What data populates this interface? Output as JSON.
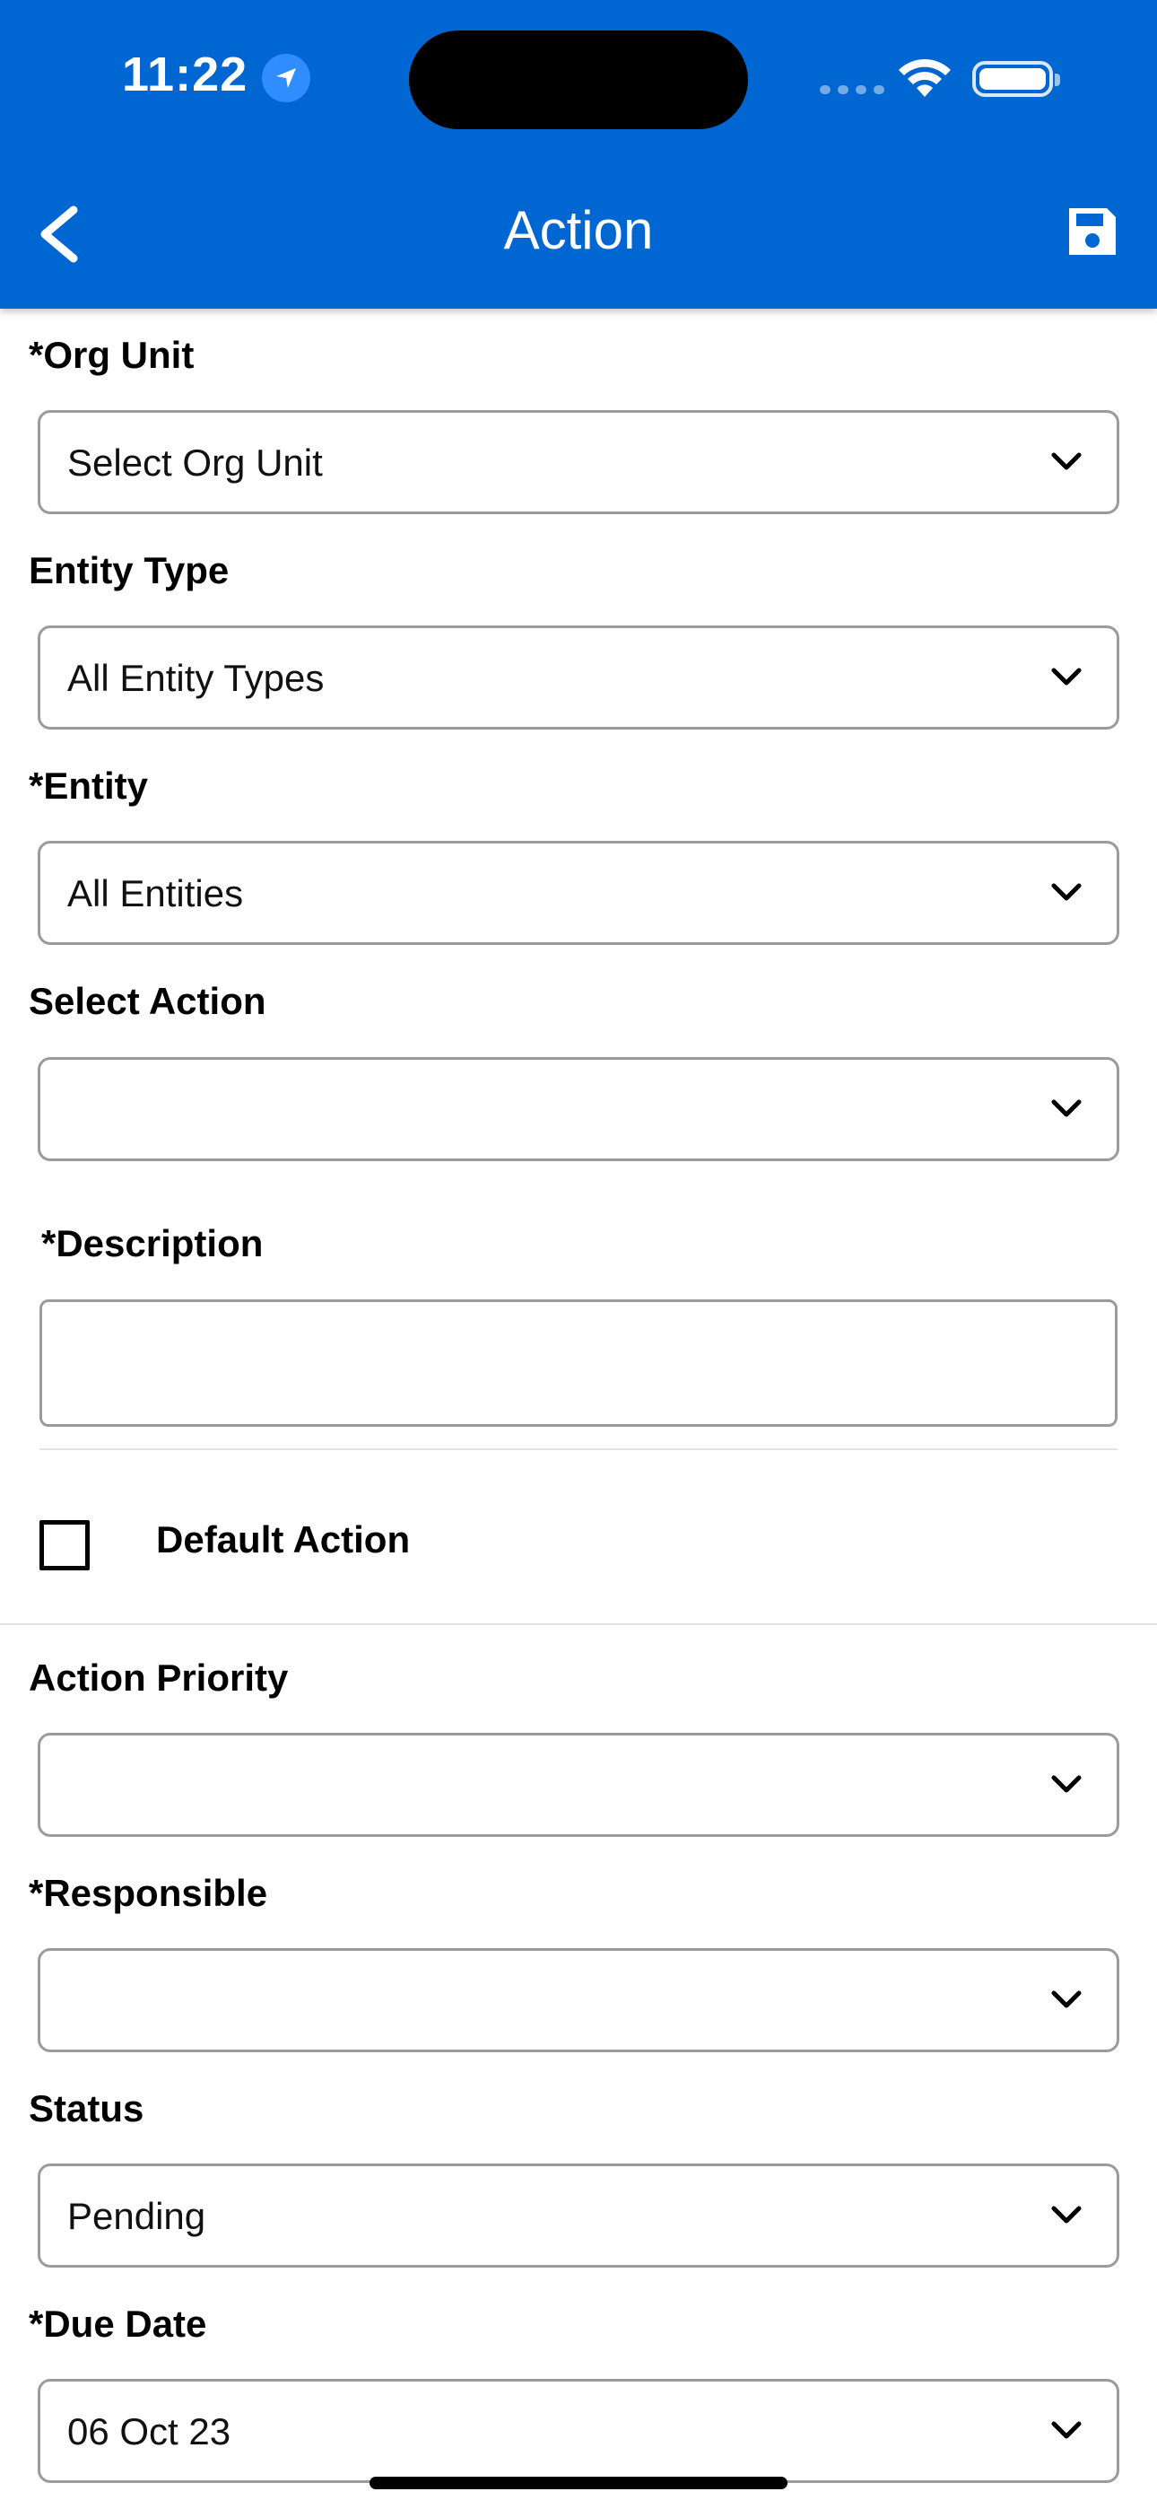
{
  "status_bar": {
    "time": "11:22"
  },
  "header": {
    "title": "Action"
  },
  "form": {
    "org_unit": {
      "label": "*Org Unit",
      "value": "Select Org Unit"
    },
    "entity_type": {
      "label": "Entity Type",
      "value": "All Entity Types"
    },
    "entity": {
      "label": "*Entity",
      "value": "All Entities"
    },
    "select_action": {
      "label": "Select Action",
      "value": ""
    },
    "description": {
      "label": "*Description",
      "value": ""
    },
    "default_action": {
      "label": "Default Action",
      "checked": false
    },
    "action_priority": {
      "label": "Action Priority",
      "value": ""
    },
    "responsible": {
      "label": "*Responsible",
      "value": ""
    },
    "status": {
      "label": "Status",
      "value": "Pending"
    },
    "due_date": {
      "label": "*Due Date",
      "value": "06 Oct 23"
    }
  },
  "colors": {
    "header_bg": "#0066d2",
    "border": "#9b9b9b"
  },
  "icons": [
    "back-chevron-icon",
    "save-icon",
    "location-arrow-icon",
    "wifi-icon",
    "battery-icon",
    "chevron-down-icon"
  ]
}
